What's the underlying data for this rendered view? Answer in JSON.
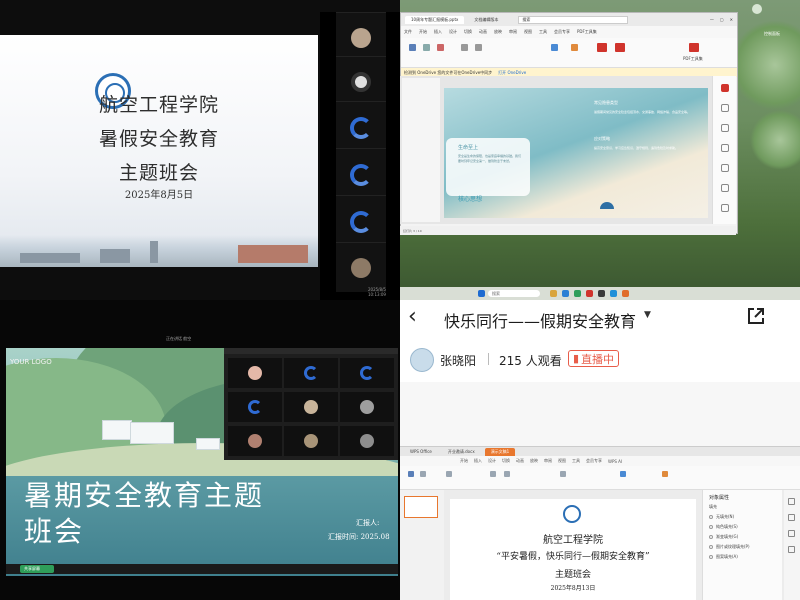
{
  "meeting_slide": {
    "school": "航空工程学院",
    "title_line1": "暑假安全教育",
    "title_line2": "主题班会",
    "date": "2025年8月5日",
    "stamp": "2025/8/5 10:13:09"
  },
  "desktop_ppt": {
    "window_tab": "10周年专题汇报模板.pptx",
    "window_tab2": "文档编辑版本",
    "search_placeholder": "搜索",
    "menu": [
      "文件",
      "开始",
      "插入",
      "设计",
      "切换",
      "动画",
      "放映",
      "审阅",
      "视图",
      "工具",
      "会员专享",
      "PDF工具集"
    ],
    "ribbon_pdf": "PDF工具集",
    "notice": "检测到 OneDrive 您的文件可在OneDrive中同步",
    "notice_button": "打开 OneDrive",
    "card_title": "生命至上",
    "card_body": "安全是生命的保障，也是家庭幸福的基础。我们要时刻牢记安全第一，做到防患于未然。",
    "core": "核心思想",
    "right_title1": "常见隐患类型",
    "right_body1": "暑假期间常见的安全隐患包括溺水、交通事故、网络诈骗、食品安全等。",
    "right_title2": "应对策略",
    "right_body2": "提高安全意识，学习应急知识，遵守规则，遇到危险及时求助。",
    "status": "幻灯片 3 / 10",
    "side_labels": [
      "保护",
      "形状",
      "动画",
      "设计",
      "截图",
      "翻译"
    ],
    "desktop_icon": "控制面板"
  },
  "projected_slide": {
    "logo": "YOUR LOGO",
    "title_line1": "暑期安全教育主题",
    "title_line2": "班会",
    "reporter": "汇报人:",
    "report_time": "汇报时间: 2025.08",
    "top_label": "正在讲话 航空",
    "bottom_button": "共享屏幕"
  },
  "live_stream": {
    "title": "快乐同行——假期安全教育",
    "host": "张晓阳",
    "viewers": "215 人观看",
    "live_label": "直播中",
    "colors": {
      "live": "#e85d4a",
      "accent_tab": "#e8772e"
    },
    "tabs": [
      "WPS Office",
      "开业邀请.docx",
      "演示文稿1"
    ],
    "menu": [
      "开始",
      "插入",
      "设计",
      "切换",
      "动画",
      "放映",
      "审阅",
      "视图",
      "工具",
      "会员专享",
      "WPS AI"
    ],
    "school": "航空工程学院",
    "subtitle": "“平安暑假，快乐同行—假期安全教育”",
    "session": "主题班会",
    "date": "2025年8月13日",
    "props_title": "对象属性",
    "props_section": "填充",
    "props_options": [
      "无填充(N)",
      "纯色填充(S)",
      "渐变填充(G)",
      "图片或纹理填充(P)",
      "图案填充(A)"
    ]
  }
}
